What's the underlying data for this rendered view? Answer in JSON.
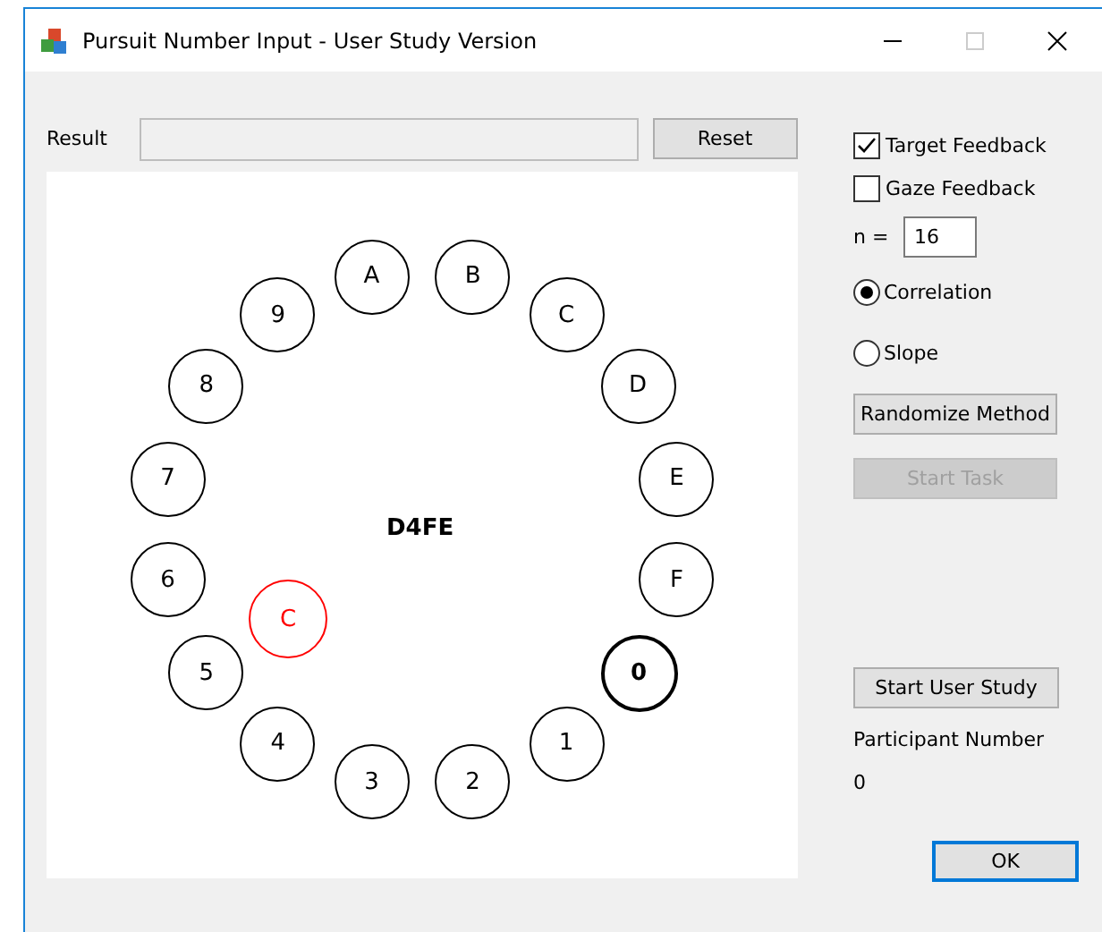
{
  "window": {
    "title": "Pursuit Number Input - User Study Version"
  },
  "result": {
    "label": "Result"
  },
  "reset_button": "Reset",
  "canvas": {
    "center_text": "D4FE",
    "targets": [
      {
        "label": "A",
        "selected": false
      },
      {
        "label": "B",
        "selected": false
      },
      {
        "label": "C",
        "selected": false
      },
      {
        "label": "D",
        "selected": false
      },
      {
        "label": "E",
        "selected": false
      },
      {
        "label": "F",
        "selected": false
      },
      {
        "label": "0",
        "selected": true
      },
      {
        "label": "1",
        "selected": false
      },
      {
        "label": "2",
        "selected": false
      },
      {
        "label": "3",
        "selected": false
      },
      {
        "label": "4",
        "selected": false
      },
      {
        "label": "5",
        "selected": false
      },
      {
        "label": "6",
        "selected": false
      },
      {
        "label": "7",
        "selected": false
      },
      {
        "label": "8",
        "selected": false
      },
      {
        "label": "9",
        "selected": false
      }
    ],
    "cursor": {
      "label": "C",
      "color": "#ff0000"
    }
  },
  "checkboxes": [
    {
      "label": "Target Feedback",
      "checked": true
    },
    {
      "label": "Gaze Feedback",
      "checked": false
    }
  ],
  "n_label": "n =",
  "n_value": "16",
  "methods": [
    {
      "label": "Correlation",
      "selected": true
    },
    {
      "label": "Slope",
      "selected": false
    }
  ],
  "buttons": [
    {
      "label": "Randomize Method",
      "disabled": false
    },
    {
      "label": "Start Task",
      "disabled": true
    }
  ],
  "user_study_button": "Start User Study",
  "participant_label": "Participant Number",
  "participant_number": "0",
  "ok_button": "OK"
}
